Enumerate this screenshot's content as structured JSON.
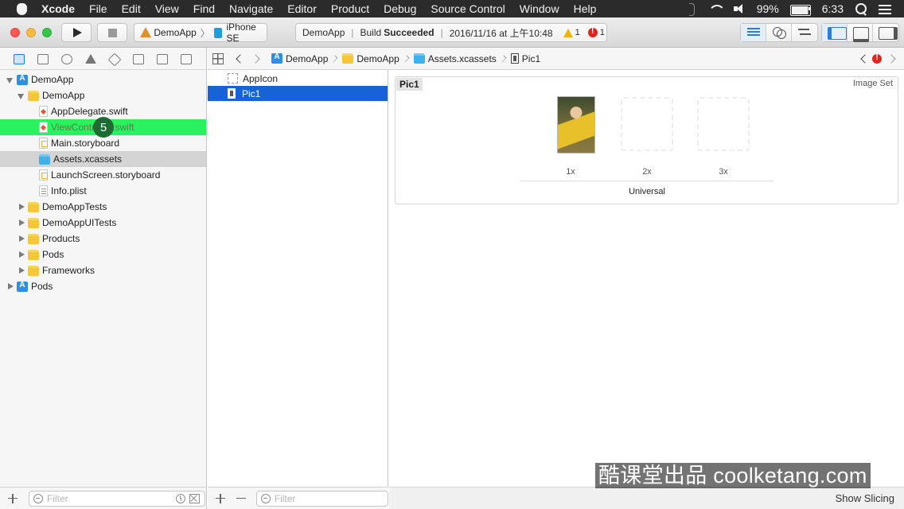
{
  "menubar": {
    "app_name": "Xcode",
    "menus": [
      "File",
      "Edit",
      "View",
      "Find",
      "Navigate",
      "Editor",
      "Product",
      "Debug",
      "Source Control",
      "Window",
      "Help"
    ],
    "battery": "99%",
    "time": "6:33"
  },
  "toolbar": {
    "scheme": "DemoApp",
    "device": "iPhone SE",
    "activity": {
      "project": "DemoApp",
      "status_prefix": "Build",
      "status": "Succeeded",
      "timestamp": "2016/11/16 at 上午10:48",
      "warnings": "1",
      "errors": "1"
    }
  },
  "navigator": {
    "tree": [
      {
        "label": "DemoApp",
        "icon": "project-icon",
        "level": 0,
        "disclosure": "open"
      },
      {
        "label": "DemoApp",
        "icon": "folder-icon",
        "level": 1,
        "disclosure": "open"
      },
      {
        "label": "AppDelegate.swift",
        "icon": "swift-file-icon",
        "level": 2,
        "disclosure": "none"
      },
      {
        "label": "ViewController.swift",
        "icon": "swift-file-icon",
        "level": 2,
        "disclosure": "none",
        "highlighted": true
      },
      {
        "label": "Main.storyboard",
        "icon": "storyboard-file-icon",
        "level": 2,
        "disclosure": "none"
      },
      {
        "label": "Assets.xcassets",
        "icon": "folder-blue-icon",
        "level": 2,
        "disclosure": "none",
        "selected": true
      },
      {
        "label": "LaunchScreen.storyboard",
        "icon": "storyboard-file-icon",
        "level": 2,
        "disclosure": "none"
      },
      {
        "label": "Info.plist",
        "icon": "plist-file-icon",
        "level": 2,
        "disclosure": "none"
      },
      {
        "label": "DemoAppTests",
        "icon": "folder-icon",
        "level": 1,
        "disclosure": "closed"
      },
      {
        "label": "DemoAppUITests",
        "icon": "folder-icon",
        "level": 1,
        "disclosure": "closed"
      },
      {
        "label": "Products",
        "icon": "folder-icon",
        "level": 1,
        "disclosure": "closed"
      },
      {
        "label": "Pods",
        "icon": "folder-icon",
        "level": 1,
        "disclosure": "closed"
      },
      {
        "label": "Frameworks",
        "icon": "folder-icon",
        "level": 1,
        "disclosure": "closed"
      },
      {
        "label": "Pods",
        "icon": "project-icon",
        "level": 0,
        "disclosure": "closed"
      }
    ],
    "step_badge": "5",
    "filter_placeholder": "Filter"
  },
  "jumpbar": {
    "crumbs": [
      "DemoApp",
      "DemoApp",
      "Assets.xcassets",
      "Pic1"
    ]
  },
  "asset_list": {
    "items": [
      {
        "label": "AppIcon",
        "selected": false
      },
      {
        "label": "Pic1",
        "selected": true
      }
    ],
    "filter_placeholder": "Filter"
  },
  "editor": {
    "imageset_name": "Pic1",
    "imageset_kind": "Image Set",
    "slots": [
      "1x",
      "2x",
      "3x"
    ],
    "idiom": "Universal",
    "footer_action": "Show Slicing"
  },
  "watermark": "酷课堂出品 coolketang.com",
  "colors": {
    "selection_blue": "#1662d7",
    "highlight_green": "#29f15f",
    "badge_green": "#1e6b34"
  }
}
